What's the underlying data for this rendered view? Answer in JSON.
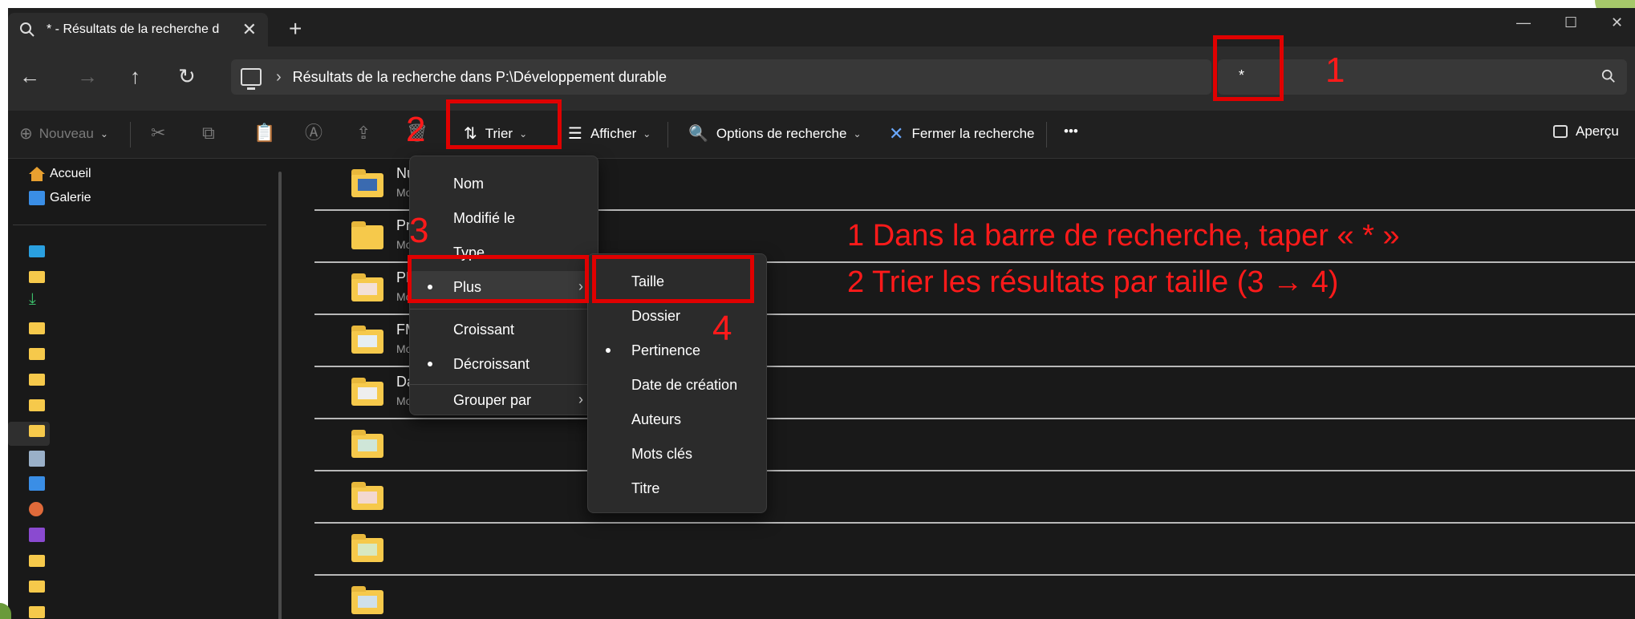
{
  "tab": {
    "title": "* - Résultats de la recherche d",
    "close": "✕",
    "new": "+"
  },
  "window_controls": {
    "minimize": "—",
    "maximize": "☐",
    "close": "✕"
  },
  "nav": {
    "back": "←",
    "forward": "→",
    "up": "↑",
    "refresh": "↻"
  },
  "address": {
    "separator": "›",
    "path": "Résultats de la recherche dans P:\\Développement durable"
  },
  "search": {
    "value": "*"
  },
  "toolbar": {
    "new_label": "Nouveau",
    "sort_label": "Trier",
    "view_label": "Afficher",
    "search_options_label": "Options de recherche",
    "close_search_label": "Fermer la recherche",
    "more_label": "•••",
    "preview_label": "Aperçu"
  },
  "sidebar": {
    "items": [
      {
        "label": "Accueil"
      },
      {
        "label": "Galerie"
      }
    ]
  },
  "content": {
    "rows": [
      {
        "name": "Nu",
        "sub": "Mo"
      },
      {
        "name": "Pré",
        "sub": "Mo"
      },
      {
        "name": "PH",
        "sub": "Mo"
      },
      {
        "name": "FM",
        "sub": "Mo"
      },
      {
        "name": "Da",
        "sub": "Mo"
      },
      {
        "name": "",
        "sub": ""
      },
      {
        "name": "",
        "sub": ""
      },
      {
        "name": "",
        "sub": ""
      },
      {
        "name": "",
        "sub": ""
      }
    ]
  },
  "sort_menu": {
    "items": [
      "Nom",
      "Modifié le",
      "Type",
      "Plus",
      "Croissant",
      "Décroissant",
      "Grouper par"
    ],
    "arrow": "›"
  },
  "more_menu": {
    "items": [
      "Taille",
      "Dossier",
      "Pertinence",
      "Date de création",
      "Auteurs",
      "Mots clés",
      "Titre"
    ]
  },
  "annotations": {
    "n1": "1",
    "n2": "2",
    "n3": "3",
    "n4": "4",
    "line1": "1 Dans la barre de recherche, taper « * »",
    "line2": "2 Trier les résultats par taille (3 → 4)"
  },
  "colors": {
    "highlight": "#e00000",
    "folder": "#f6c94b",
    "background": "#191919"
  }
}
